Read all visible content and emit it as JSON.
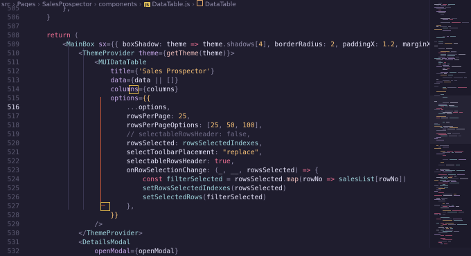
{
  "breadcrumb": {
    "segments": [
      "src",
      "Pages",
      "SalesProspector",
      "components",
      "DataTable.js",
      "DataTable"
    ],
    "icons": [
      "js-file-icon",
      "component-icon"
    ]
  },
  "editor": {
    "active_line": "516",
    "lines": [
      {
        "n": "505",
        "tokens": [
          [
            "        ",
            "punc"
          ],
          [
            "},",
            "punc"
          ]
        ]
      },
      {
        "n": "506",
        "tokens": [
          [
            "    ",
            "punc"
          ],
          [
            "}",
            "punc"
          ]
        ]
      },
      {
        "n": "507",
        "tokens": []
      },
      {
        "n": "508",
        "tokens": [
          [
            "    ",
            "punc"
          ],
          [
            "return",
            "kw"
          ],
          [
            " (",
            "punc"
          ]
        ]
      },
      {
        "n": "509",
        "tokens": [
          [
            "        ",
            "punc"
          ],
          [
            "<",
            "punc"
          ],
          [
            "MainBox",
            "tag"
          ],
          [
            " ",
            "punc"
          ],
          [
            "sx",
            "attr"
          ],
          [
            "=",
            "op"
          ],
          [
            "{{ ",
            "punc"
          ],
          [
            "boxShadow",
            "var"
          ],
          [
            ": ",
            "punc"
          ],
          [
            "theme",
            "var"
          ],
          [
            " => ",
            "kw"
          ],
          [
            "theme",
            "var"
          ],
          [
            ".shadows[",
            "punc"
          ],
          [
            "4",
            "num"
          ],
          [
            "], ",
            "punc"
          ],
          [
            "borderRadius",
            "var"
          ],
          [
            ": ",
            "punc"
          ],
          [
            "2",
            "num"
          ],
          [
            ", ",
            "punc"
          ],
          [
            "paddingX",
            "var"
          ],
          [
            ": ",
            "punc"
          ],
          [
            "1.2",
            "num"
          ],
          [
            ", ",
            "punc"
          ],
          [
            "marginX",
            "var"
          ],
          [
            ": ",
            "punc"
          ],
          [
            "-1",
            "num"
          ],
          [
            " }}",
            "punc"
          ],
          [
            ">",
            "punc"
          ]
        ]
      },
      {
        "n": "510",
        "tokens": [
          [
            "            ",
            "punc"
          ],
          [
            "<",
            "punc"
          ],
          [
            "ThemeProvider",
            "tag"
          ],
          [
            " ",
            "punc"
          ],
          [
            "theme",
            "attr"
          ],
          [
            "=",
            "op"
          ],
          [
            "{",
            "punc"
          ],
          [
            "getTheme",
            "fn"
          ],
          [
            "(",
            "punc"
          ],
          [
            "theme",
            "var"
          ],
          [
            ")}",
            "punc"
          ],
          [
            ">",
            "punc"
          ]
        ]
      },
      {
        "n": "511",
        "tokens": [
          [
            "                ",
            "punc"
          ],
          [
            "<",
            "punc"
          ],
          [
            "MUIDataTable",
            "tag"
          ]
        ]
      },
      {
        "n": "512",
        "tokens": [
          [
            "                    ",
            "punc"
          ],
          [
            "title",
            "attr"
          ],
          [
            "=",
            "op"
          ],
          [
            "{",
            "punc"
          ],
          [
            "'Sales Prospector'",
            "str"
          ],
          [
            "}",
            "punc"
          ]
        ]
      },
      {
        "n": "513",
        "tokens": [
          [
            "                    ",
            "punc"
          ],
          [
            "data",
            "attr"
          ],
          [
            "=",
            "op"
          ],
          [
            "{",
            "punc"
          ],
          [
            "data",
            "var"
          ],
          [
            " || ",
            "op"
          ],
          [
            "[]",
            "punc"
          ],
          [
            "}",
            "punc"
          ]
        ]
      },
      {
        "n": "514",
        "tokens": [
          [
            "                    ",
            "punc"
          ],
          [
            "columns",
            "attr"
          ],
          [
            "=",
            "op"
          ],
          [
            "{",
            "punc"
          ],
          [
            "columns",
            "var"
          ],
          [
            "}",
            "punc"
          ]
        ]
      },
      {
        "n": "515",
        "tokens": [
          [
            "                    ",
            "punc"
          ],
          [
            "options",
            "attr"
          ],
          [
            "=",
            "op"
          ],
          [
            "{{",
            "yellow"
          ]
        ]
      },
      {
        "n": "516",
        "tokens": [
          [
            "                        ",
            "punc"
          ],
          [
            "...",
            "op"
          ],
          [
            "options",
            "var"
          ],
          [
            ",",
            "punc"
          ]
        ]
      },
      {
        "n": "517",
        "tokens": [
          [
            "                        ",
            "punc"
          ],
          [
            "rowsPerPage",
            "var"
          ],
          [
            ": ",
            "punc"
          ],
          [
            "25",
            "num"
          ],
          [
            ",",
            "punc"
          ]
        ]
      },
      {
        "n": "518",
        "tokens": [
          [
            "                        ",
            "punc"
          ],
          [
            "rowsPerPageOptions",
            "var"
          ],
          [
            ": ",
            "punc"
          ],
          [
            "[",
            "punc"
          ],
          [
            "25",
            "num"
          ],
          [
            ", ",
            "punc"
          ],
          [
            "50",
            "num"
          ],
          [
            ", ",
            "punc"
          ],
          [
            "100",
            "num"
          ],
          [
            "],",
            "punc"
          ]
        ]
      },
      {
        "n": "519",
        "tokens": [
          [
            "                        ",
            "punc"
          ],
          [
            "// selectableRowsHeader: false,",
            "comment"
          ]
        ]
      },
      {
        "n": "520",
        "tokens": [
          [
            "                        ",
            "punc"
          ],
          [
            "rowsSelected",
            "var"
          ],
          [
            ": ",
            "punc"
          ],
          [
            "rowsSelectedIndexes",
            "ident"
          ],
          [
            ",",
            "punc"
          ]
        ]
      },
      {
        "n": "521",
        "tokens": [
          [
            "                        ",
            "punc"
          ],
          [
            "selectToolbarPlacement",
            "var"
          ],
          [
            ": ",
            "punc"
          ],
          [
            "\"replace\"",
            "str"
          ],
          [
            ",",
            "punc"
          ]
        ]
      },
      {
        "n": "522",
        "tokens": [
          [
            "                        ",
            "punc"
          ],
          [
            "selectableRowsHeader",
            "var"
          ],
          [
            ": ",
            "punc"
          ],
          [
            "true",
            "kw"
          ],
          [
            ",",
            "punc"
          ]
        ]
      },
      {
        "n": "523",
        "tokens": [
          [
            "                        ",
            "punc"
          ],
          [
            "onRowSelectionChange",
            "var"
          ],
          [
            ": ",
            "punc"
          ],
          [
            "(",
            "punc"
          ],
          [
            "_",
            "var"
          ],
          [
            ", ",
            "punc"
          ],
          [
            "__",
            "var"
          ],
          [
            ", ",
            "punc"
          ],
          [
            "rowsSelected",
            "var"
          ],
          [
            ")",
            "punc"
          ],
          [
            " => ",
            "kw"
          ],
          [
            "{",
            "punc"
          ]
        ]
      },
      {
        "n": "524",
        "tokens": [
          [
            "                            ",
            "punc"
          ],
          [
            "const",
            "kw"
          ],
          [
            " ",
            "punc"
          ],
          [
            "filterSelected",
            "ident"
          ],
          [
            " = ",
            "op"
          ],
          [
            "rowsSelected",
            "var"
          ],
          [
            ".",
            "punc"
          ],
          [
            "map",
            "fn"
          ],
          [
            "(",
            "punc"
          ],
          [
            "rowNo",
            "var"
          ],
          [
            " => ",
            "kw"
          ],
          [
            "salesList",
            "ident"
          ],
          [
            "[",
            "punc"
          ],
          [
            "rowNo",
            "var"
          ],
          [
            "])",
            "punc"
          ]
        ]
      },
      {
        "n": "525",
        "tokens": [
          [
            "                            ",
            "punc"
          ],
          [
            "setRowsSelectedIndexes",
            "ident"
          ],
          [
            "(",
            "punc"
          ],
          [
            "rowsSelected",
            "var"
          ],
          [
            ")",
            "punc"
          ]
        ]
      },
      {
        "n": "526",
        "tokens": [
          [
            "                            ",
            "punc"
          ],
          [
            "setSelectedRows",
            "ident"
          ],
          [
            "(",
            "punc"
          ],
          [
            "filterSelected",
            "var"
          ],
          [
            ")",
            "punc"
          ]
        ]
      },
      {
        "n": "527",
        "tokens": [
          [
            "                        ",
            "punc"
          ],
          [
            "},",
            "punc"
          ]
        ]
      },
      {
        "n": "528",
        "tokens": [
          [
            "                    ",
            "punc"
          ],
          [
            "}}",
            "yellow"
          ]
        ]
      },
      {
        "n": "529",
        "tokens": [
          [
            "                ",
            "punc"
          ],
          [
            "/>",
            "punc"
          ]
        ]
      },
      {
        "n": "530",
        "tokens": [
          [
            "            ",
            "punc"
          ],
          [
            "</",
            "punc"
          ],
          [
            "ThemeProvider",
            "tag"
          ],
          [
            ">",
            "punc"
          ]
        ]
      },
      {
        "n": "531",
        "tokens": [
          [
            "            ",
            "punc"
          ],
          [
            "<",
            "punc"
          ],
          [
            "DetailsModal",
            "tag"
          ]
        ]
      },
      {
        "n": "532",
        "tokens": [
          [
            "                ",
            "punc"
          ],
          [
            "openModal",
            "attr"
          ],
          [
            "=",
            "op"
          ],
          [
            "{",
            "punc"
          ],
          [
            "openModal",
            "var"
          ],
          [
            "}",
            "punc"
          ]
        ]
      }
    ]
  },
  "colors": {
    "background": "#1f1d2e",
    "keyword": "#eb6f92",
    "tag": "#9ccfd8",
    "attribute": "#c4a7e7",
    "string": "#f6c177",
    "comment": "#6e6a86",
    "bracket_highlight": "#c4573a"
  }
}
